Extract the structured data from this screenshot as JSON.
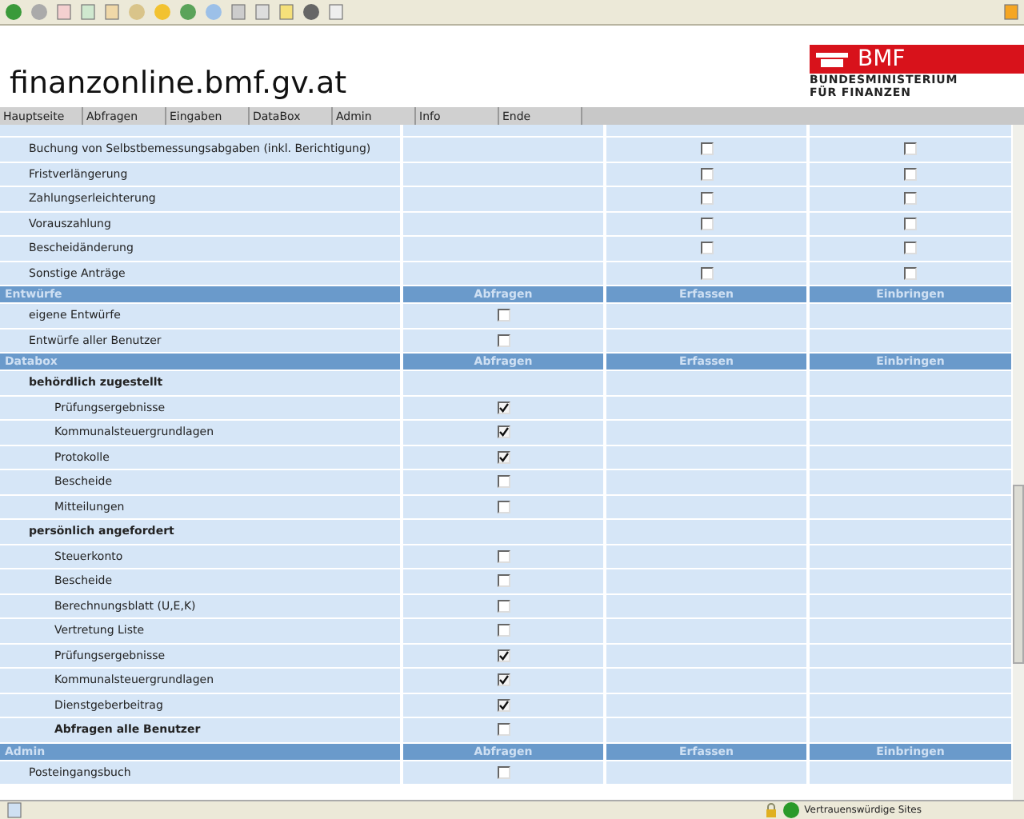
{
  "site_title": "finanzonline.bmf.gv.at",
  "logo": {
    "mark": "BMF",
    "line1": "BUNDESMINISTERIUM",
    "line2": "FÜR FINANZEN"
  },
  "nav": [
    "Hauptseite",
    "Abfragen",
    "Eingaben",
    "DataBox",
    "Admin",
    "Info",
    "Ende"
  ],
  "table": {
    "sections": [
      {
        "rows": [
          {
            "kind": "item",
            "label": "Buchung von Selbstbemessungsabgaben (inkl. Berichtigung)",
            "checks": {
              "erfassen": false,
              "einbringen": false
            }
          },
          {
            "kind": "item",
            "label": "Fristverlängerung",
            "checks": {
              "erfassen": false,
              "einbringen": false
            }
          },
          {
            "kind": "item",
            "label": "Zahlungserleichterung",
            "checks": {
              "erfassen": false,
              "einbringen": false
            }
          },
          {
            "kind": "item",
            "label": "Vorauszahlung",
            "checks": {
              "erfassen": false,
              "einbringen": false
            }
          },
          {
            "kind": "item",
            "label": "Bescheidänderung",
            "checks": {
              "erfassen": false,
              "einbringen": false
            }
          },
          {
            "kind": "item",
            "label": "Sonstige Anträge",
            "checks": {
              "erfassen": false,
              "einbringen": false
            }
          }
        ]
      },
      {
        "header": [
          "Entwürfe",
          "Abfragen",
          "Erfassen",
          "Einbringen"
        ],
        "rows": [
          {
            "kind": "item",
            "label": "eigene Entwürfe",
            "checks": {
              "abfragen": false
            }
          },
          {
            "kind": "item",
            "label": "Entwürfe aller Benutzer",
            "checks": {
              "abfragen": false
            }
          }
        ]
      },
      {
        "header": [
          "Databox",
          "Abfragen",
          "Erfassen",
          "Einbringen"
        ],
        "rows": [
          {
            "kind": "group",
            "label": "behördlich zugestellt",
            "children": [
              {
                "kind": "item",
                "label": "Prüfungsergebnisse",
                "checks": {
                  "abfragen": true
                }
              },
              {
                "kind": "item",
                "label": "Kommunalsteuergrundlagen",
                "checks": {
                  "abfragen": true
                }
              },
              {
                "kind": "item",
                "label": "Protokolle",
                "checks": {
                  "abfragen": true
                }
              },
              {
                "kind": "item",
                "label": "Bescheide",
                "checks": {
                  "abfragen": false
                }
              },
              {
                "kind": "item",
                "label": "Mitteilungen",
                "checks": {
                  "abfragen": false
                }
              }
            ]
          },
          {
            "kind": "group",
            "label": "persönlich angefordert",
            "children": [
              {
                "kind": "item",
                "label": "Steuerkonto",
                "checks": {
                  "abfragen": false
                }
              },
              {
                "kind": "item",
                "label": "Bescheide",
                "checks": {
                  "abfragen": false
                }
              },
              {
                "kind": "item",
                "label": "Berechnungsblatt (U,E,K)",
                "checks": {
                  "abfragen": false
                }
              },
              {
                "kind": "item",
                "label": "Vertretung Liste",
                "checks": {
                  "abfragen": false
                }
              },
              {
                "kind": "item",
                "label": "Prüfungsergebnisse",
                "checks": {
                  "abfragen": true
                }
              },
              {
                "kind": "item",
                "label": "Kommunalsteuergrundlagen",
                "checks": {
                  "abfragen": true
                }
              },
              {
                "kind": "item",
                "label": "Dienstgeberbeitrag",
                "checks": {
                  "abfragen": true
                }
              },
              {
                "kind": "summary",
                "label": "Abfragen alle Benutzer",
                "checks": {
                  "abfragen": false
                }
              }
            ]
          }
        ]
      },
      {
        "header": [
          "Admin",
          "Abfragen",
          "Erfassen",
          "Einbringen"
        ],
        "rows": [
          {
            "kind": "item",
            "label": "Posteingangsbuch",
            "checks": {
              "abfragen": false
            }
          }
        ]
      }
    ]
  },
  "status_bar": {
    "zone": "Vertrauenswürdige Sites"
  }
}
